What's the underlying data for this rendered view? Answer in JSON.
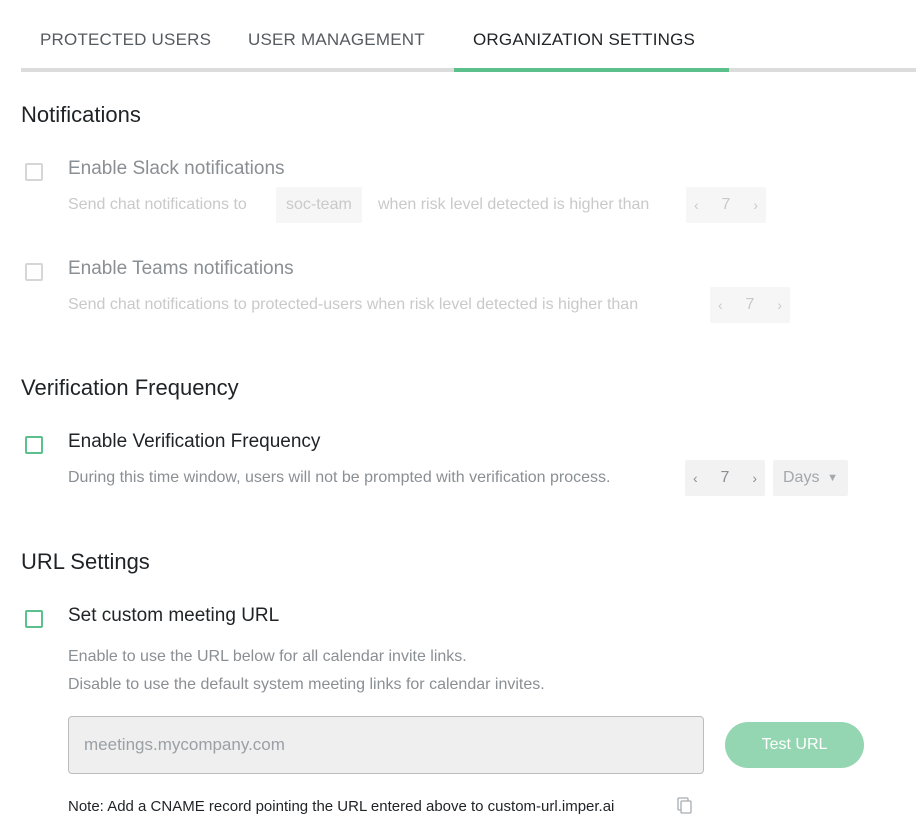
{
  "tabs": [
    {
      "label": "PROTECTED USERS"
    },
    {
      "label": "USER MANAGEMENT"
    },
    {
      "label": "ORGANIZATION SETTINGS",
      "active": true
    }
  ],
  "notifications": {
    "title": "Notifications",
    "slack": {
      "label": "Enable Slack notifications",
      "desc_prefix": "Send chat notifications to",
      "channel": "soc-team",
      "desc_suffix": "when risk level detected is higher than",
      "level": "7"
    },
    "teams": {
      "label": "Enable Teams notifications",
      "desc": "Send chat notifications to protected-users when risk level detected is higher than",
      "level": "7"
    }
  },
  "verification": {
    "title": "Verification Frequency",
    "label": "Enable Verification Frequency",
    "desc": "During this time window, users will not be prompted with verification process.",
    "value": "7",
    "unit": "Days"
  },
  "url_settings": {
    "title": "URL Settings",
    "label": "Set custom meeting URL",
    "desc_line1": "Enable to use the URL below for all calendar invite links.",
    "desc_line2": "Disable to use the default system meeting links for calendar invites.",
    "input_value": "",
    "input_placeholder": "meetings.mycompany.com",
    "test_button": "Test URL",
    "note": "Note: Add a CNAME record pointing the URL entered above to custom-url.imper.ai"
  },
  "icons": {
    "prev": "chevron-left-icon",
    "next": "chevron-right-icon",
    "caret": "caret-down-icon",
    "copy": "copy-icon"
  },
  "colors": {
    "accent": "#5cc08c",
    "button": "#94d6b1"
  },
  "glyphs": {
    "prev": "‹",
    "next": "›",
    "caret": "▼"
  }
}
